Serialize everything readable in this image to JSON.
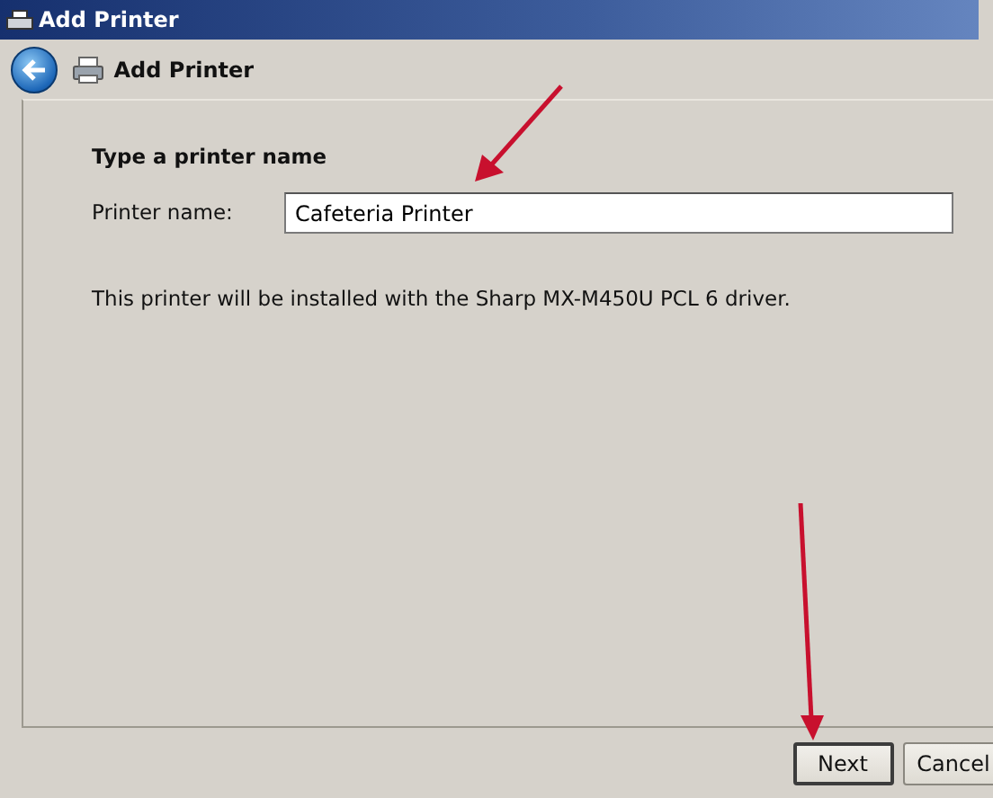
{
  "window": {
    "title": "Add Printer"
  },
  "header": {
    "title": "Add Printer"
  },
  "content": {
    "heading": "Type a printer name",
    "field": {
      "label": "Printer name:",
      "value": "Cafeteria Printer"
    },
    "note": "This printer will be installed with the Sharp MX-M450U PCL 6 driver."
  },
  "buttons": [
    {
      "label": "Next",
      "default": true
    },
    {
      "label": "Cancel",
      "default": false
    }
  ]
}
